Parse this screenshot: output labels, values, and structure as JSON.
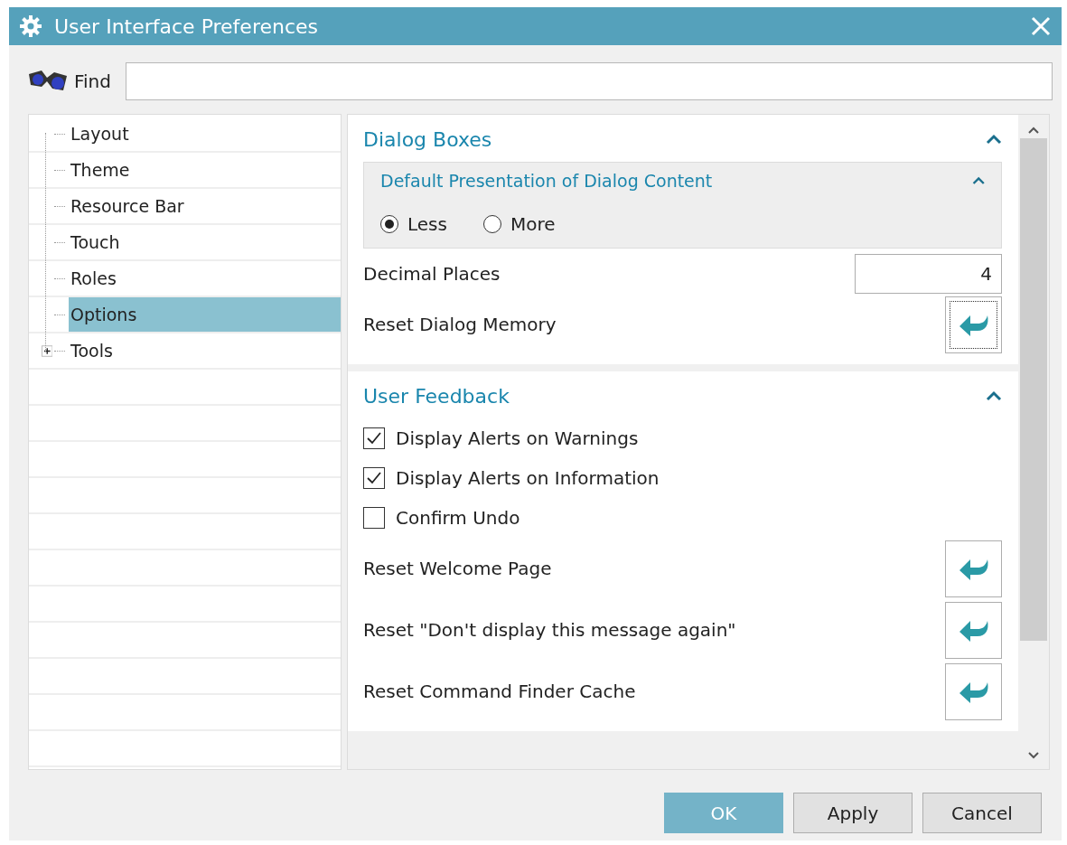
{
  "window": {
    "title": "User Interface Preferences"
  },
  "find": {
    "label": "Find"
  },
  "tree": {
    "items": [
      {
        "label": "Layout",
        "selected": false
      },
      {
        "label": "Theme",
        "selected": false
      },
      {
        "label": "Resource Bar",
        "selected": false
      },
      {
        "label": "Touch",
        "selected": false
      },
      {
        "label": "Roles",
        "selected": false
      },
      {
        "label": "Options",
        "selected": true
      },
      {
        "label": "Tools",
        "selected": false,
        "expanded": false
      }
    ]
  },
  "sections": [
    {
      "title": "Dialog Boxes",
      "expanded": true,
      "group": {
        "title": "Default Presentation of Dialog Content",
        "expanded": true,
        "options": [
          {
            "label": "Less",
            "selected": true
          },
          {
            "label": "More",
            "selected": false
          }
        ]
      },
      "rows": [
        {
          "kind": "number",
          "label": "Decimal Places",
          "value": "4"
        },
        {
          "kind": "reset",
          "label": "Reset Dialog Memory",
          "focused": true
        }
      ]
    },
    {
      "title": "User Feedback",
      "expanded": true,
      "rows": [
        {
          "kind": "checkbox",
          "label": "Display Alerts on Warnings",
          "checked": true
        },
        {
          "kind": "checkbox",
          "label": "Display Alerts on Information",
          "checked": true
        },
        {
          "kind": "checkbox",
          "label": "Confirm Undo",
          "checked": false
        },
        {
          "kind": "reset",
          "label": "Reset Welcome Page",
          "focused": false
        },
        {
          "kind": "reset",
          "label": "Reset \"Don't display this message again\"",
          "focused": false
        },
        {
          "kind": "reset",
          "label": "Reset Command Finder Cache",
          "focused": false
        }
      ]
    }
  ],
  "buttons": [
    {
      "label": "OK",
      "default": true
    },
    {
      "label": "Apply",
      "default": false
    },
    {
      "label": "Cancel",
      "default": false
    }
  ]
}
